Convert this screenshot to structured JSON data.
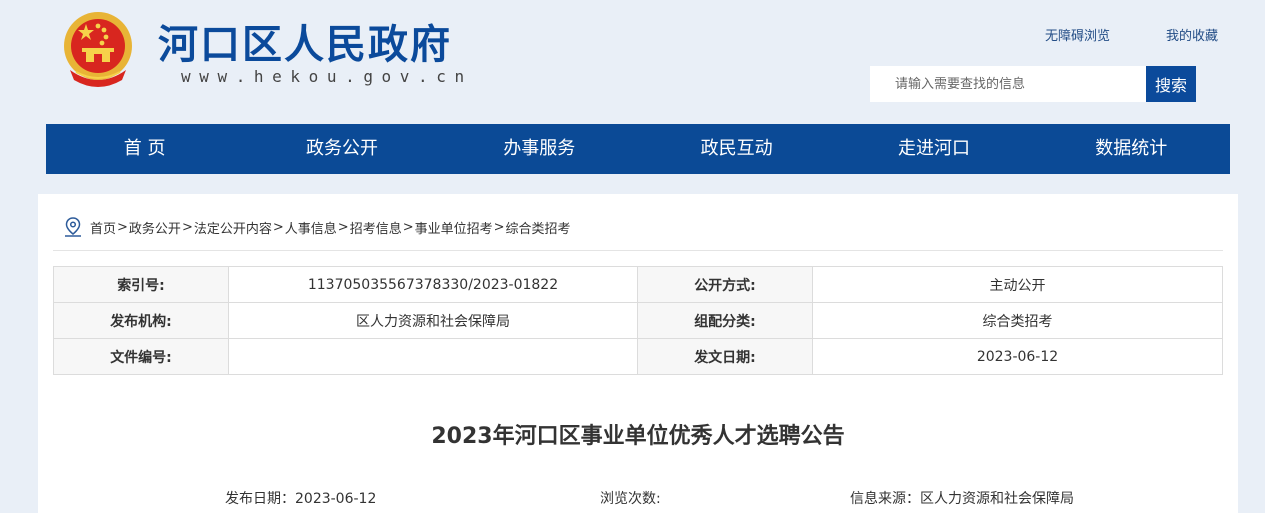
{
  "header": {
    "title": "河口区人民政府",
    "domain": "www.hekou.gov.cn",
    "links": {
      "accessibility": "无障碍浏览",
      "favorites": "我的收藏"
    },
    "search": {
      "placeholder": "请输入需要查找的信息",
      "button": "搜索"
    },
    "emblem_icon": "national-emblem-icon"
  },
  "nav": [
    "首 页",
    "政务公开",
    "办事服务",
    "政民互动",
    "走进河口",
    "数据统计"
  ],
  "breadcrumb": [
    "首页",
    "政务公开",
    "法定公开内容",
    "人事信息",
    "招考信息",
    "事业单位招考",
    "综合类招考"
  ],
  "meta": {
    "index_label": "索引号:",
    "index_value": "113705035567378330/2023-01822",
    "mode_label": "公开方式:",
    "mode_value": "主动公开",
    "org_label": "发布机构:",
    "org_value": "区人力资源和社会保障局",
    "category_label": "组配分类:",
    "category_value": "综合类招考",
    "docno_label": "文件编号:",
    "docno_value": "",
    "date_label": "发文日期:",
    "date_value": "2023-06-12"
  },
  "article": {
    "title": "2023年河口区事业单位优秀人才选聘公告",
    "publish_date": "发布日期：2023-06-12",
    "views": "浏览次数:",
    "source": "信息来源：区人力资源和社会保障局"
  },
  "colors": {
    "brand": "#0b4a9b",
    "nav_bg": "#0b4a96",
    "page_bg": "#e9eff7"
  }
}
